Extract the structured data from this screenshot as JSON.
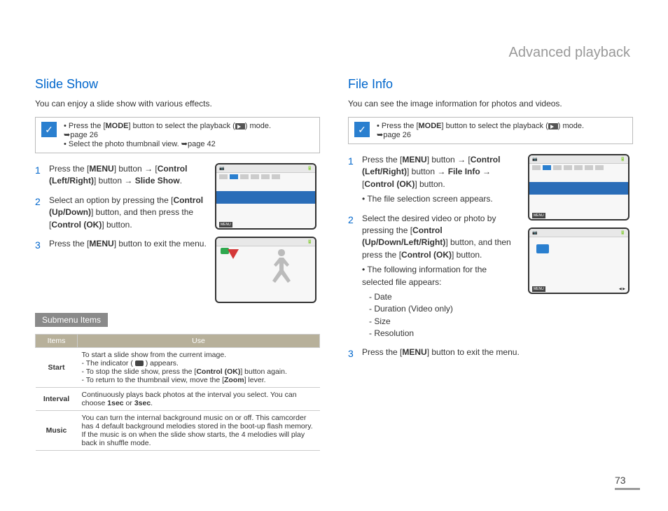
{
  "chapter": "Advanced playback",
  "page_number": "73",
  "left": {
    "heading": "Slide Show",
    "intro": "You can enjoy a slide show with various effects.",
    "notebox": {
      "line1_pre": "Press the [",
      "line1_mode": "MODE",
      "line1_mid": "] button to select the playback (",
      "line1_post": ") mode.",
      "ref1": "➥page 26",
      "line2": "Select the photo thumbnail view. ➥page 42"
    },
    "steps": {
      "s1_a": "Press the [",
      "s1_menu": "MENU",
      "s1_b": "] button → [",
      "s1_ctrl": "Control (Left/Right)",
      "s1_c": "] button → ",
      "s1_target": "Slide Show",
      "s1_d": ".",
      "s2_a": "Select an option by pressing the [",
      "s2_ctrl": "Control (Up/Down)",
      "s2_b": "] button, and then press the [",
      "s2_ok": "Control (OK)",
      "s2_c": "] button.",
      "s3_a": "Press the [",
      "s3_menu": "MENU",
      "s3_b": "] button to exit the menu."
    },
    "submenu_label": "Submenu Items",
    "table": {
      "h1": "Items",
      "h2": "Use",
      "r1_item": "Start",
      "r1_lead": "To start a slide show from the current image.",
      "r1_b1a": "The indicator (",
      "r1_b1b": ") appears.",
      "r1_b2a": "To stop the slide show, press the [",
      "r1_b2_ok": "Control (OK)",
      "r1_b2b": "] button again.",
      "r1_b3a": "To return to the thumbnail view, move the [",
      "r1_b3_zoom": "Zoom",
      "r1_b3b": "] lever.",
      "r2_item": "Interval",
      "r2_a": "Continuously plays back photos at the interval you select. You can choose ",
      "r2_opt1": "1sec",
      "r2_or": " or ",
      "r2_opt2": "3sec",
      "r2_b": ".",
      "r3_item": "Music",
      "r3_use": "You can turn the internal background music on or off. This camcorder has 4 default background melodies stored in the boot-up flash memory. If the music is on when the slide show starts, the 4 melodies will play back in shuffle mode."
    }
  },
  "right": {
    "heading": "File Info",
    "intro": "You can see the image information for photos and videos.",
    "notebox": {
      "line1_pre": "Press the [",
      "line1_mode": "MODE",
      "line1_mid": "] button to select the playback (",
      "line1_post": ") mode.",
      "ref1": "➥page 26"
    },
    "steps": {
      "s1_a": "Press the [",
      "s1_menu": "MENU",
      "s1_b": "] button → [",
      "s1_ctrl": "Control (Left/Right)",
      "s1_c": "] button → ",
      "s1_target": "File Info",
      "s1_d": " → [",
      "s1_ok": "Control (OK)",
      "s1_e": "] button.",
      "s1_sub": "The file selection screen appears.",
      "s2_a": "Select the desired video or photo by pressing the [",
      "s2_ctrl": "Control (Up/Down/Left/Right)",
      "s2_b": "] button, and then press the [",
      "s2_ok": "Control (OK)",
      "s2_c": "] button.",
      "s2_sub_lead": "The following information for the selected file appears:",
      "s2_li1": "Date",
      "s2_li2": "Duration (Video only)",
      "s2_li3": "Size",
      "s2_li4": "Resolution",
      "s3_a": "Press the [",
      "s3_menu": "MENU",
      "s3_b": "] button to exit the menu."
    }
  },
  "ui_labels": {
    "menu": "MENU"
  }
}
